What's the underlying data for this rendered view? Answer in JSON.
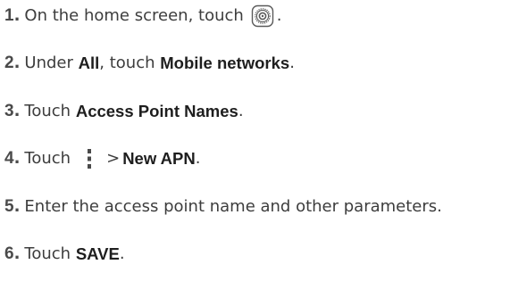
{
  "steps": [
    {
      "num": "1",
      "dot": ".",
      "text": "On the home screen, touch",
      "end": "."
    },
    {
      "num": "2",
      "dot": ".",
      "pre": "Under",
      "bold1": "All",
      "mid": ", touch",
      "bold2": "Mobile networks",
      "end": "."
    },
    {
      "num": "3",
      "dot": ".",
      "pre": "Touch",
      "bold1": "Access Point Names",
      "end": "."
    },
    {
      "num": "4",
      "dot": ".",
      "pre": "Touch",
      "gt": ">",
      "bold1": "New APN",
      "end": "."
    },
    {
      "num": "5",
      "dot": ".",
      "text": "Enter the access point name and other parameters."
    },
    {
      "num": "6",
      "dot": ".",
      "pre": "Touch",
      "bold1": "SAVE",
      "end": "."
    }
  ],
  "icons": {
    "settings": "settings-gear-icon",
    "menu": "more-options-icon"
  },
  "colors": {
    "text": "#3d3d3d",
    "bold": "#1e1e1e",
    "number": "#4a4a4a"
  }
}
